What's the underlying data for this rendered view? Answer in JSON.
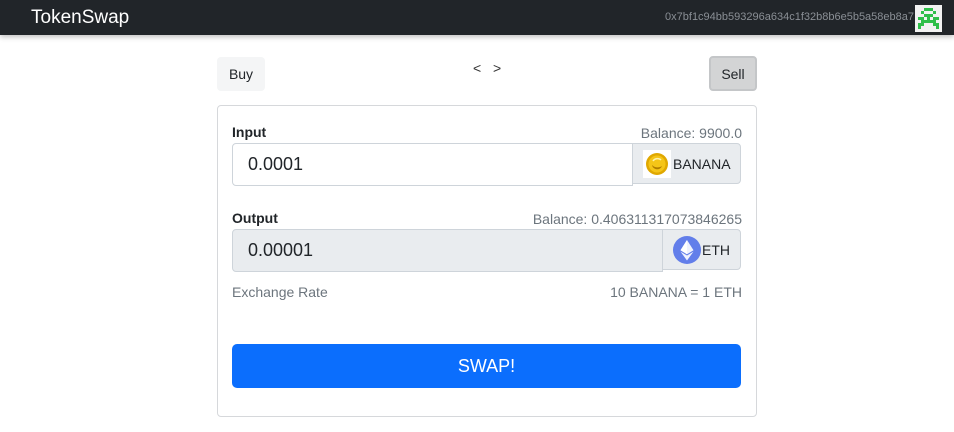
{
  "navbar": {
    "brand": "TokenSwap",
    "address": "0x7bf1c94bb593296a634c1f32b8b6e5b5a58eb8a7"
  },
  "mode": {
    "buy_label": "Buy",
    "sell_label": "Sell",
    "prev_label": "<",
    "next_label": ">"
  },
  "input": {
    "label": "Input",
    "balance": "Balance: 9900.0",
    "value": "0.0001",
    "token": "BANANA"
  },
  "output": {
    "label": "Output",
    "balance": "Balance: 0.406311317073846265",
    "value": "0.00001",
    "token": "ETH"
  },
  "exchange": {
    "label": "Exchange Rate",
    "rate": "10 BANANA = 1 ETH"
  },
  "swap_label": "SWAP!",
  "colors": {
    "navbar_bg": "#212529",
    "swap_button": "#0b6efd",
    "identicon": "#2fbf4a",
    "eth_icon": "#627eea",
    "banana_icon": "#e0a800"
  }
}
